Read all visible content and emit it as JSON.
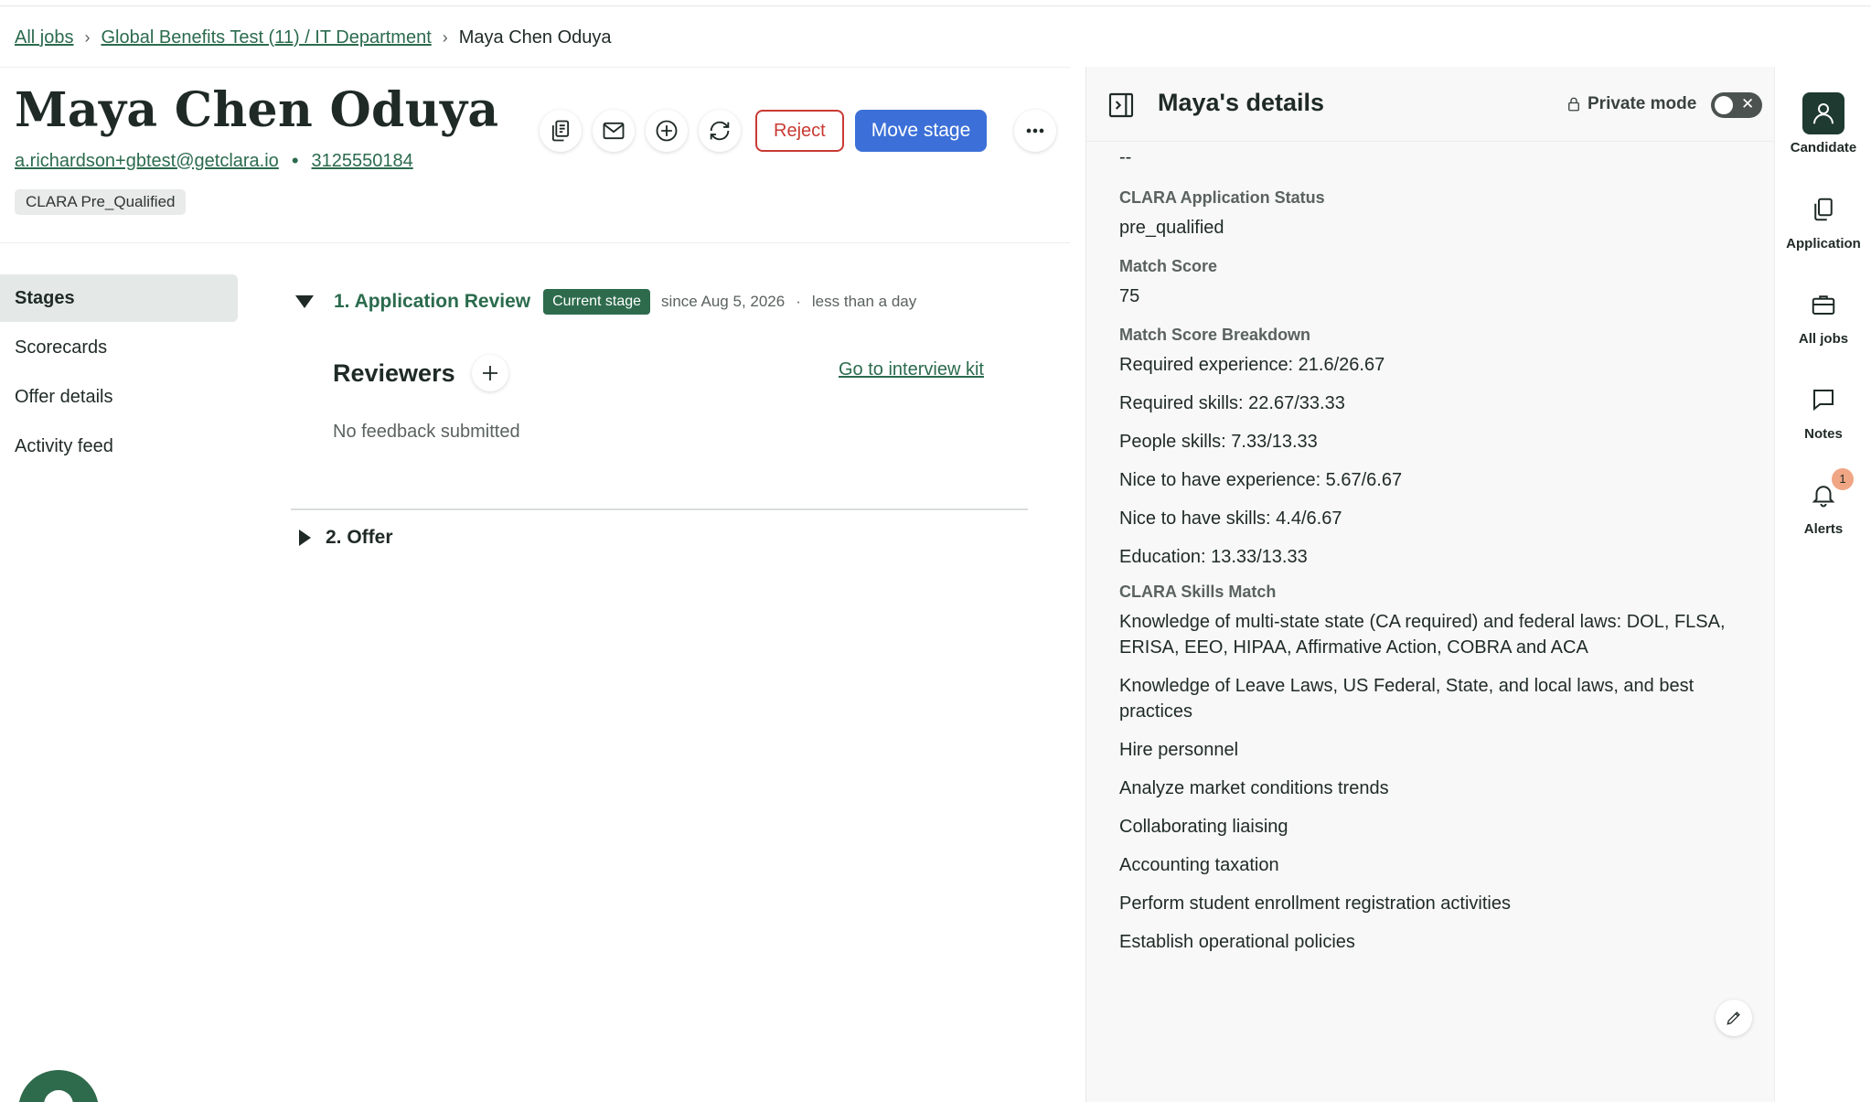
{
  "breadcrumb": {
    "all_jobs": "All jobs",
    "job": "Global Benefits Test (11) / IT Department",
    "current": "Maya Chen Oduya",
    "sep": "›"
  },
  "candidate": {
    "name": "Maya Chen Oduya",
    "email": "a.richardson+gbtest@getclara.io",
    "phone": "3125550184",
    "dot": "•",
    "tag": "CLARA Pre_Qualified"
  },
  "actions": {
    "reject": "Reject",
    "move_stage": "Move stage"
  },
  "nav": {
    "stages": "Stages",
    "scorecards": "Scorecards",
    "offer_details": "Offer details",
    "activity_feed": "Activity feed"
  },
  "stages": {
    "stage1": {
      "title": "1. Application Review",
      "badge": "Current stage",
      "since": "since Aug 5, 2026",
      "dot": "·",
      "duration": "less than a day"
    },
    "reviewers": "Reviewers",
    "interview_kit": "Go to interview kit",
    "no_feedback": "No feedback submitted",
    "stage2": {
      "title": "2. Offer"
    }
  },
  "panel": {
    "title": "Maya's details",
    "private_mode": "Private mode",
    "toggle_x": "✕",
    "dash": "--",
    "status_label": "CLARA Application Status",
    "status_value": "pre_qualified",
    "match_label": "Match Score",
    "match_value": "75",
    "breakdown_label": "Match Score Breakdown",
    "breakdown": [
      "Required experience: 21.6/26.67",
      "Required skills: 22.67/33.33",
      "People skills: 7.33/13.33",
      "Nice to have experience: 5.67/6.67",
      "Nice to have skills: 4.4/6.67",
      "Education: 13.33/13.33"
    ],
    "skills_label": "CLARA Skills Match",
    "skills": [
      "Knowledge of multi-state state (CA required) and federal laws: DOL, FLSA, ERISA, EEO, HIPAA, Affirmative Action, COBRA and ACA",
      "Knowledge of Leave Laws, US Federal, State, and local laws, and best practices",
      "Hire personnel",
      "Analyze market conditions trends",
      "Collaborating liaising",
      "Accounting taxation",
      "Perform student enrollment registration activities",
      "Establish operational policies"
    ]
  },
  "rail": {
    "candidate": "Candidate",
    "application": "Application",
    "all_jobs": "All jobs",
    "notes": "Notes",
    "alerts": "Alerts",
    "alerts_count": "1"
  },
  "colors": {
    "brand_green": "#2e6b4c",
    "link_green": "#2b6b4d",
    "primary_blue": "#3c70d8",
    "reject_red": "#c93a33"
  }
}
